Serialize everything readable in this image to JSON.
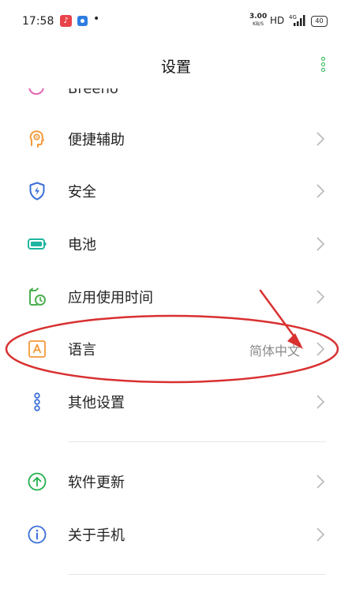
{
  "status_bar": {
    "time": "17:58",
    "speed_value": "3.00",
    "speed_unit": "KB/S",
    "hd": "HD",
    "network": "4G",
    "battery": "40"
  },
  "header": {
    "title": "设置"
  },
  "partial_row_label": "Breeno",
  "items": [
    {
      "label": "便捷辅助",
      "icon": "assist-icon",
      "color": "#f29a3a"
    },
    {
      "label": "安全",
      "icon": "shield-icon",
      "color": "#3b6fd8"
    },
    {
      "label": "电池",
      "icon": "battery-icon",
      "color": "#1fb5a0"
    },
    {
      "label": "应用使用时间",
      "icon": "app-time-icon",
      "color": "#4caf50"
    },
    {
      "label": "语言",
      "value": "简体中文",
      "icon": "language-icon",
      "color": "#f29a3a"
    },
    {
      "label": "其他设置",
      "icon": "other-settings-icon",
      "color": "#3b6fd8"
    },
    {
      "label": "软件更新",
      "icon": "update-icon",
      "color": "#22b14c"
    },
    {
      "label": "关于手机",
      "icon": "info-icon",
      "color": "#3b6fd8"
    }
  ],
  "colors": {
    "accent": "#22b14c",
    "annotation": "#d93030",
    "chevron": "#b8b8b8"
  }
}
